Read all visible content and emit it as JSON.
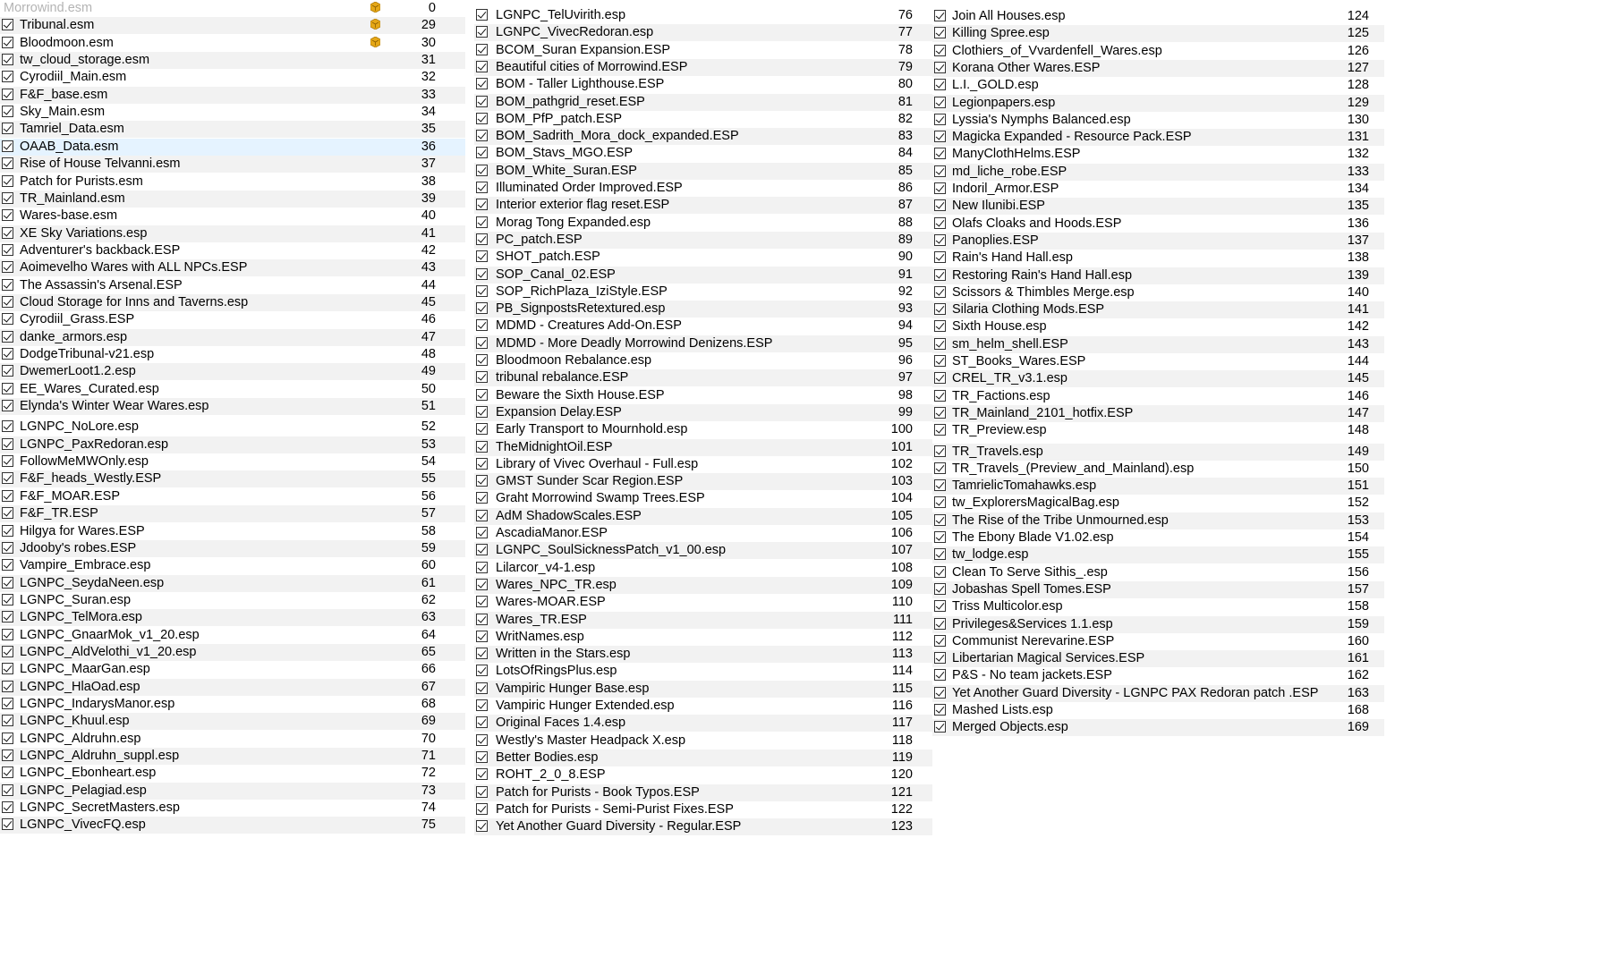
{
  "flag_color": "#e6a817",
  "columns": [
    {
      "rows": [
        {
          "name": "Morrowind.esm",
          "index": "0",
          "checked": false,
          "master": true
        },
        {
          "name": "Tribunal.esm",
          "index": "29",
          "checked": true,
          "master": true
        },
        {
          "name": "Bloodmoon.esm",
          "index": "30",
          "checked": true,
          "master": true
        },
        {
          "name": "tw_cloud_storage.esm",
          "index": "31",
          "checked": true
        },
        {
          "name": "Cyrodiil_Main.esm",
          "index": "32",
          "checked": true
        },
        {
          "name": "F&F_base.esm",
          "index": "33",
          "checked": true
        },
        {
          "name": "Sky_Main.esm",
          "index": "34",
          "checked": true
        },
        {
          "name": "Tamriel_Data.esm",
          "index": "35",
          "checked": true
        },
        {
          "name": "OAAB_Data.esm",
          "index": "36",
          "checked": true,
          "selected": true
        },
        {
          "name": "Rise of House Telvanni.esm",
          "index": "37",
          "checked": true
        },
        {
          "name": "Patch for Purists.esm",
          "index": "38",
          "checked": true
        },
        {
          "name": "TR_Mainland.esm",
          "index": "39",
          "checked": true
        },
        {
          "name": "Wares-base.esm",
          "index": "40",
          "checked": true
        },
        {
          "name": "XE Sky Variations.esp",
          "index": "41",
          "checked": true
        },
        {
          "name": "Adventurer's backback.ESP",
          "index": "42",
          "checked": true
        },
        {
          "name": "Aoimevelho Wares with ALL NPCs.ESP",
          "index": "43",
          "checked": true
        },
        {
          "name": "The Assassin's Arsenal.ESP",
          "index": "44",
          "checked": true
        },
        {
          "name": "Cloud Storage for Inns and Taverns.esp",
          "index": "45",
          "checked": true
        },
        {
          "name": "Cyrodiil_Grass.ESP",
          "index": "46",
          "checked": true
        },
        {
          "name": "danke_armors.esp",
          "index": "47",
          "checked": true
        },
        {
          "name": "DodgeTribunal-v21.esp",
          "index": "48",
          "checked": true
        },
        {
          "name": "DwemerLoot1.2.esp",
          "index": "49",
          "checked": true
        },
        {
          "name": "EE_Wares_Curated.esp",
          "index": "50",
          "checked": true
        },
        {
          "name": "Elynda's Winter Wear Wares.esp",
          "index": "51",
          "checked": true
        },
        {
          "name": "LGNPC_NoLore.esp",
          "index": "52",
          "checked": true
        },
        {
          "name": "LGNPC_PaxRedoran.esp",
          "index": "53",
          "checked": true
        },
        {
          "name": "FollowMeMWOnly.esp",
          "index": "54",
          "checked": true
        },
        {
          "name": "F&F_heads_Westly.ESP",
          "index": "55",
          "checked": true
        },
        {
          "name": "F&F_MOAR.ESP",
          "index": "56",
          "checked": true
        },
        {
          "name": "F&F_TR.ESP",
          "index": "57",
          "checked": true
        },
        {
          "name": "Hilgya for Wares.ESP",
          "index": "58",
          "checked": true
        },
        {
          "name": "Jdooby's robes.ESP",
          "index": "59",
          "checked": true
        },
        {
          "name": "Vampire_Embrace.esp",
          "index": "60",
          "checked": true
        },
        {
          "name": "LGNPC_SeydaNeen.esp",
          "index": "61",
          "checked": true
        },
        {
          "name": "LGNPC_Suran.esp",
          "index": "62",
          "checked": true
        },
        {
          "name": "LGNPC_TelMora.esp",
          "index": "63",
          "checked": true
        },
        {
          "name": "LGNPC_GnaarMok_v1_20.esp",
          "index": "64",
          "checked": true
        },
        {
          "name": "LGNPC_AldVelothi_v1_20.esp",
          "index": "65",
          "checked": true
        },
        {
          "name": "LGNPC_MaarGan.esp",
          "index": "66",
          "checked": true
        },
        {
          "name": "LGNPC_HlaOad.esp",
          "index": "67",
          "checked": true
        },
        {
          "name": "LGNPC_IndarysManor.esp",
          "index": "68",
          "checked": true
        },
        {
          "name": "LGNPC_Khuul.esp",
          "index": "69",
          "checked": true
        },
        {
          "name": "LGNPC_Aldruhn.esp",
          "index": "70",
          "checked": true
        },
        {
          "name": "LGNPC_Aldruhn_suppl.esp",
          "index": "71",
          "checked": true
        },
        {
          "name": "LGNPC_Ebonheart.esp",
          "index": "72",
          "checked": true
        },
        {
          "name": "LGNPC_Pelagiad.esp",
          "index": "73",
          "checked": true
        },
        {
          "name": "LGNPC_SecretMasters.esp",
          "index": "74",
          "checked": true
        },
        {
          "name": "LGNPC_VivecFQ.esp",
          "index": "75",
          "checked": true
        }
      ]
    },
    {
      "rows": [
        {
          "name": "LGNPC_TelUvirith.esp",
          "index": "76",
          "checked": true
        },
        {
          "name": "LGNPC_VivecRedoran.esp",
          "index": "77",
          "checked": true
        },
        {
          "name": "BCOM_Suran Expansion.ESP",
          "index": "78",
          "checked": true
        },
        {
          "name": "Beautiful cities of Morrowind.ESP",
          "index": "79",
          "checked": true
        },
        {
          "name": "BOM - Taller Lighthouse.ESP",
          "index": "80",
          "checked": true
        },
        {
          "name": "BOM_pathgrid_reset.ESP",
          "index": "81",
          "checked": true
        },
        {
          "name": "BOM_PfP_patch.ESP",
          "index": "82",
          "checked": true
        },
        {
          "name": "BOM_Sadrith_Mora_dock_expanded.ESP",
          "index": "83",
          "checked": true
        },
        {
          "name": "BOM_Stavs_MGO.ESP",
          "index": "84",
          "checked": true
        },
        {
          "name": "BOM_White_Suran.ESP",
          "index": "85",
          "checked": true
        },
        {
          "name": "Illuminated Order Improved.ESP",
          "index": "86",
          "checked": true
        },
        {
          "name": "Interior exterior flag reset.ESP",
          "index": "87",
          "checked": true
        },
        {
          "name": "Morag Tong Expanded.esp",
          "index": "88",
          "checked": true
        },
        {
          "name": "PC_patch.ESP",
          "index": "89",
          "checked": true
        },
        {
          "name": "SHOT_patch.ESP",
          "index": "90",
          "checked": true
        },
        {
          "name": "SOP_Canal_02.ESP",
          "index": "91",
          "checked": true
        },
        {
          "name": "SOP_RichPlaza_IziStyle.ESP",
          "index": "92",
          "checked": true
        },
        {
          "name": "PB_SignpostsRetextured.esp",
          "index": "93",
          "checked": true
        },
        {
          "name": "MDMD - Creatures Add-On.ESP",
          "index": "94",
          "checked": true
        },
        {
          "name": "MDMD - More Deadly Morrowind Denizens.ESP",
          "index": "95",
          "checked": true
        },
        {
          "name": "Bloodmoon Rebalance.esp",
          "index": "96",
          "checked": true
        },
        {
          "name": "tribunal rebalance.ESP",
          "index": "97",
          "checked": true
        },
        {
          "name": "Beware the Sixth House.ESP",
          "index": "98",
          "checked": true
        },
        {
          "name": "Expansion Delay.ESP",
          "index": "99",
          "checked": true
        },
        {
          "name": "Early Transport to Mournhold.esp",
          "index": "100",
          "checked": true
        },
        {
          "name": "TheMidnightOil.ESP",
          "index": "101",
          "checked": true
        },
        {
          "name": "Library of Vivec Overhaul - Full.esp",
          "index": "102",
          "checked": true
        },
        {
          "name": "GMST Sunder Scar Region.ESP",
          "index": "103",
          "checked": true
        },
        {
          "name": "Graht Morrowind Swamp Trees.ESP",
          "index": "104",
          "checked": true
        },
        {
          "name": "AdM ShadowScales.ESP",
          "index": "105",
          "checked": true
        },
        {
          "name": "AscadiaManor.ESP",
          "index": "106",
          "checked": true
        },
        {
          "name": "LGNPC_SoulSicknessPatch_v1_00.esp",
          "index": "107",
          "checked": true
        },
        {
          "name": "Lilarcor_v4-1.esp",
          "index": "108",
          "checked": true
        },
        {
          "name": "Wares_NPC_TR.esp",
          "index": "109",
          "checked": true
        },
        {
          "name": "Wares-MOAR.ESP",
          "index": "110",
          "checked": true
        },
        {
          "name": "Wares_TR.ESP",
          "index": "111",
          "checked": true
        },
        {
          "name": "WritNames.esp",
          "index": "112",
          "checked": true
        },
        {
          "name": "Written in the Stars.esp",
          "index": "113",
          "checked": true
        },
        {
          "name": "LotsOfRingsPlus.esp",
          "index": "114",
          "checked": true
        },
        {
          "name": "Vampiric Hunger Base.esp",
          "index": "115",
          "checked": true
        },
        {
          "name": "Vampiric Hunger Extended.esp",
          "index": "116",
          "checked": true
        },
        {
          "name": "Original Faces 1.4.esp",
          "index": "117",
          "checked": true
        },
        {
          "name": "Westly's Master Headpack X.esp",
          "index": "118",
          "checked": true
        },
        {
          "name": "Better Bodies.esp",
          "index": "119",
          "checked": true
        },
        {
          "name": "ROHT_2_0_8.ESP",
          "index": "120",
          "checked": true
        },
        {
          "name": "Patch for Purists - Book Typos.ESP",
          "index": "121",
          "checked": true
        },
        {
          "name": "Patch for Purists - Semi-Purist Fixes.ESP",
          "index": "122",
          "checked": true
        },
        {
          "name": "Yet Another Guard Diversity - Regular.ESP",
          "index": "123",
          "checked": true
        }
      ]
    },
    {
      "rows": [
        {
          "name": "Join All Houses.esp",
          "index": "124",
          "checked": true
        },
        {
          "name": "Killing Spree.esp",
          "index": "125",
          "checked": true
        },
        {
          "name": "Clothiers_of_Vvardenfell_Wares.esp",
          "index": "126",
          "checked": true
        },
        {
          "name": "Korana Other Wares.ESP",
          "index": "127",
          "checked": true
        },
        {
          "name": "L.I._GOLD.esp",
          "index": "128",
          "checked": true
        },
        {
          "name": "Legionpapers.esp",
          "index": "129",
          "checked": true
        },
        {
          "name": "Lyssia's Nymphs Balanced.esp",
          "index": "130",
          "checked": true
        },
        {
          "name": "Magicka Expanded - Resource Pack.ESP",
          "index": "131",
          "checked": true
        },
        {
          "name": "ManyClothHelms.ESP",
          "index": "132",
          "checked": true
        },
        {
          "name": "md_liche_robe.ESP",
          "index": "133",
          "checked": true
        },
        {
          "name": "Indoril_Armor.ESP",
          "index": "134",
          "checked": true
        },
        {
          "name": "New Ilunibi.ESP",
          "index": "135",
          "checked": true
        },
        {
          "name": "Olafs Cloaks and Hoods.ESP",
          "index": "136",
          "checked": true
        },
        {
          "name": "Panoplies.ESP",
          "index": "137",
          "checked": true
        },
        {
          "name": "Rain's Hand Hall.esp",
          "index": "138",
          "checked": true
        },
        {
          "name": "Restoring Rain's Hand Hall.esp",
          "index": "139",
          "checked": true
        },
        {
          "name": "Scissors & Thimbles Merge.esp",
          "index": "140",
          "checked": true
        },
        {
          "name": "Silaria Clothing Mods.ESP",
          "index": "141",
          "checked": true
        },
        {
          "name": "Sixth House.esp",
          "index": "142",
          "checked": true
        },
        {
          "name": "sm_helm_shell.ESP",
          "index": "143",
          "checked": true
        },
        {
          "name": "ST_Books_Wares.ESP",
          "index": "144",
          "checked": true
        },
        {
          "name": "CREL_TR_v3.1.esp",
          "index": "145",
          "checked": true
        },
        {
          "name": "TR_Factions.esp",
          "index": "146",
          "checked": true
        },
        {
          "name": "TR_Mainland_2101_hotfix.ESP",
          "index": "147",
          "checked": true
        },
        {
          "name": "TR_Preview.esp",
          "index": "148",
          "checked": true
        },
        {
          "name": "TR_Travels.esp",
          "index": "149",
          "checked": true
        },
        {
          "name": "TR_Travels_(Preview_and_Mainland).esp",
          "index": "150",
          "checked": true
        },
        {
          "name": "TamrielicTomahawks.esp",
          "index": "151",
          "checked": true
        },
        {
          "name": "tw_ExplorersMagicalBag.esp",
          "index": "152",
          "checked": true
        },
        {
          "name": "The Rise of the Tribe Unmourned.esp",
          "index": "153",
          "checked": true
        },
        {
          "name": "The Ebony Blade V1.02.esp",
          "index": "154",
          "checked": true
        },
        {
          "name": "tw_lodge.esp",
          "index": "155",
          "checked": true
        },
        {
          "name": "Clean To Serve Sithis_.esp",
          "index": "156",
          "checked": true
        },
        {
          "name": "Jobashas Spell Tomes.ESP",
          "index": "157",
          "checked": true
        },
        {
          "name": "Triss Multicolor.esp",
          "index": "158",
          "checked": true
        },
        {
          "name": "Privileges&Services 1.1.esp",
          "index": "159",
          "checked": true
        },
        {
          "name": "Communist Nerevarine.ESP",
          "index": "160",
          "checked": true
        },
        {
          "name": "Libertarian Magical Services.ESP",
          "index": "161",
          "checked": true
        },
        {
          "name": "P&S -  No team jackets.ESP",
          "index": "162",
          "checked": true
        },
        {
          "name": "Yet Another Guard Diversity - LGNPC PAX Redoran patch .ESP",
          "index": "163",
          "checked": true
        },
        {
          "name": "Mashed Lists.esp",
          "index": "168",
          "checked": true
        },
        {
          "name": "Merged Objects.esp",
          "index": "169",
          "checked": true
        }
      ]
    }
  ]
}
